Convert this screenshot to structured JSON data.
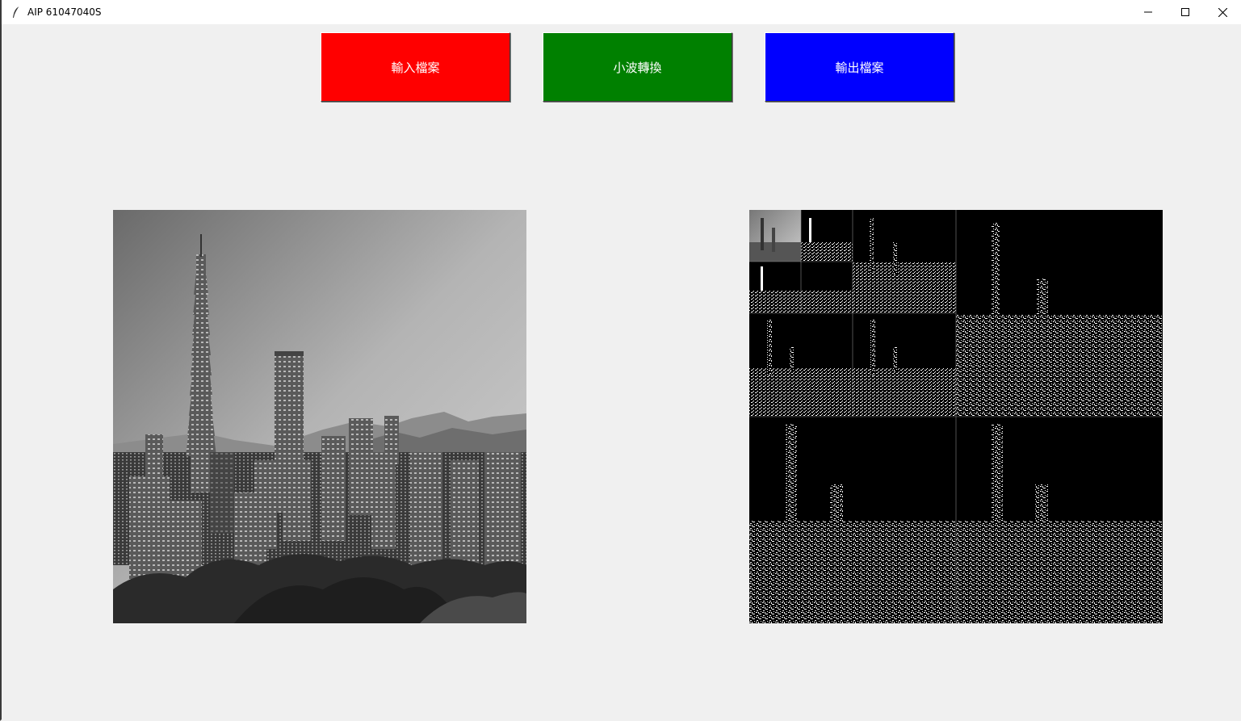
{
  "window": {
    "title": "AIP 61047040S",
    "icon": "feather-icon",
    "controls": [
      "minimize-icon",
      "maximize-icon",
      "close-icon"
    ]
  },
  "toolbar": {
    "input_label": "輸入檔案",
    "input_color": "#ff0000",
    "wavelet_label": "小波轉換",
    "wavelet_color": "#008000",
    "output_label": "輸出檔案",
    "output_color": "#0000ff"
  },
  "images": {
    "original": "grayscale-taipei-skyline-image",
    "wavelet": "wavelet-transform-result-image"
  }
}
